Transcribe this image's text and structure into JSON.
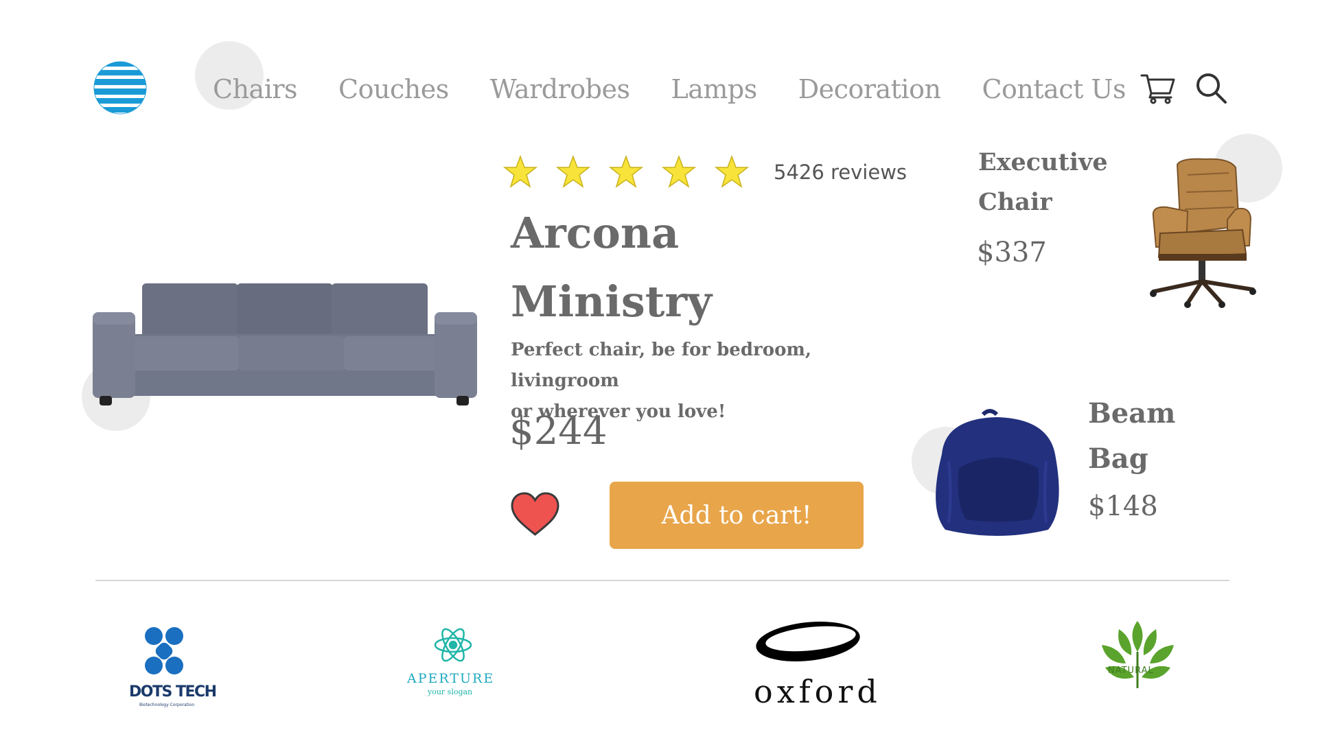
{
  "nav": {
    "logo": "att-globe-logo",
    "items": [
      "Chairs",
      "Couches",
      "Wardrobes",
      "Lamps",
      "Decoration",
      "Contact Us"
    ],
    "icons": [
      "cart-icon",
      "search-icon"
    ]
  },
  "featured": {
    "rating_stars": 5,
    "reviews": "5426 reviews",
    "title_line1": "Arcona",
    "title_line2": "Ministry",
    "description_line1": "Perfect chair, be for bedroom, livingroom",
    "description_line2": "or wherever you love!",
    "price": "$244",
    "add_to_cart": "Add to cart!"
  },
  "side_products": [
    {
      "name_line1": "Executive",
      "name_line2": "Chair",
      "price": "$337"
    },
    {
      "name_line1": "Beam",
      "name_line2": "Bag",
      "price": "$148"
    }
  ],
  "brands": {
    "dots_tech": {
      "name": "DOTS TECH",
      "tagline": "Biotechnology Corporation"
    },
    "aperture": {
      "name": "APERTURE",
      "tagline": "your slogan"
    },
    "oxford": {
      "name": "oxford"
    },
    "natural": {
      "name": "NATURAL"
    }
  },
  "colors": {
    "accent": "#e8a54a",
    "nav_text": "#9a9a9a",
    "heading_text": "#6a6a6a",
    "star": "#f7e33a",
    "heart": "#ef5350"
  }
}
